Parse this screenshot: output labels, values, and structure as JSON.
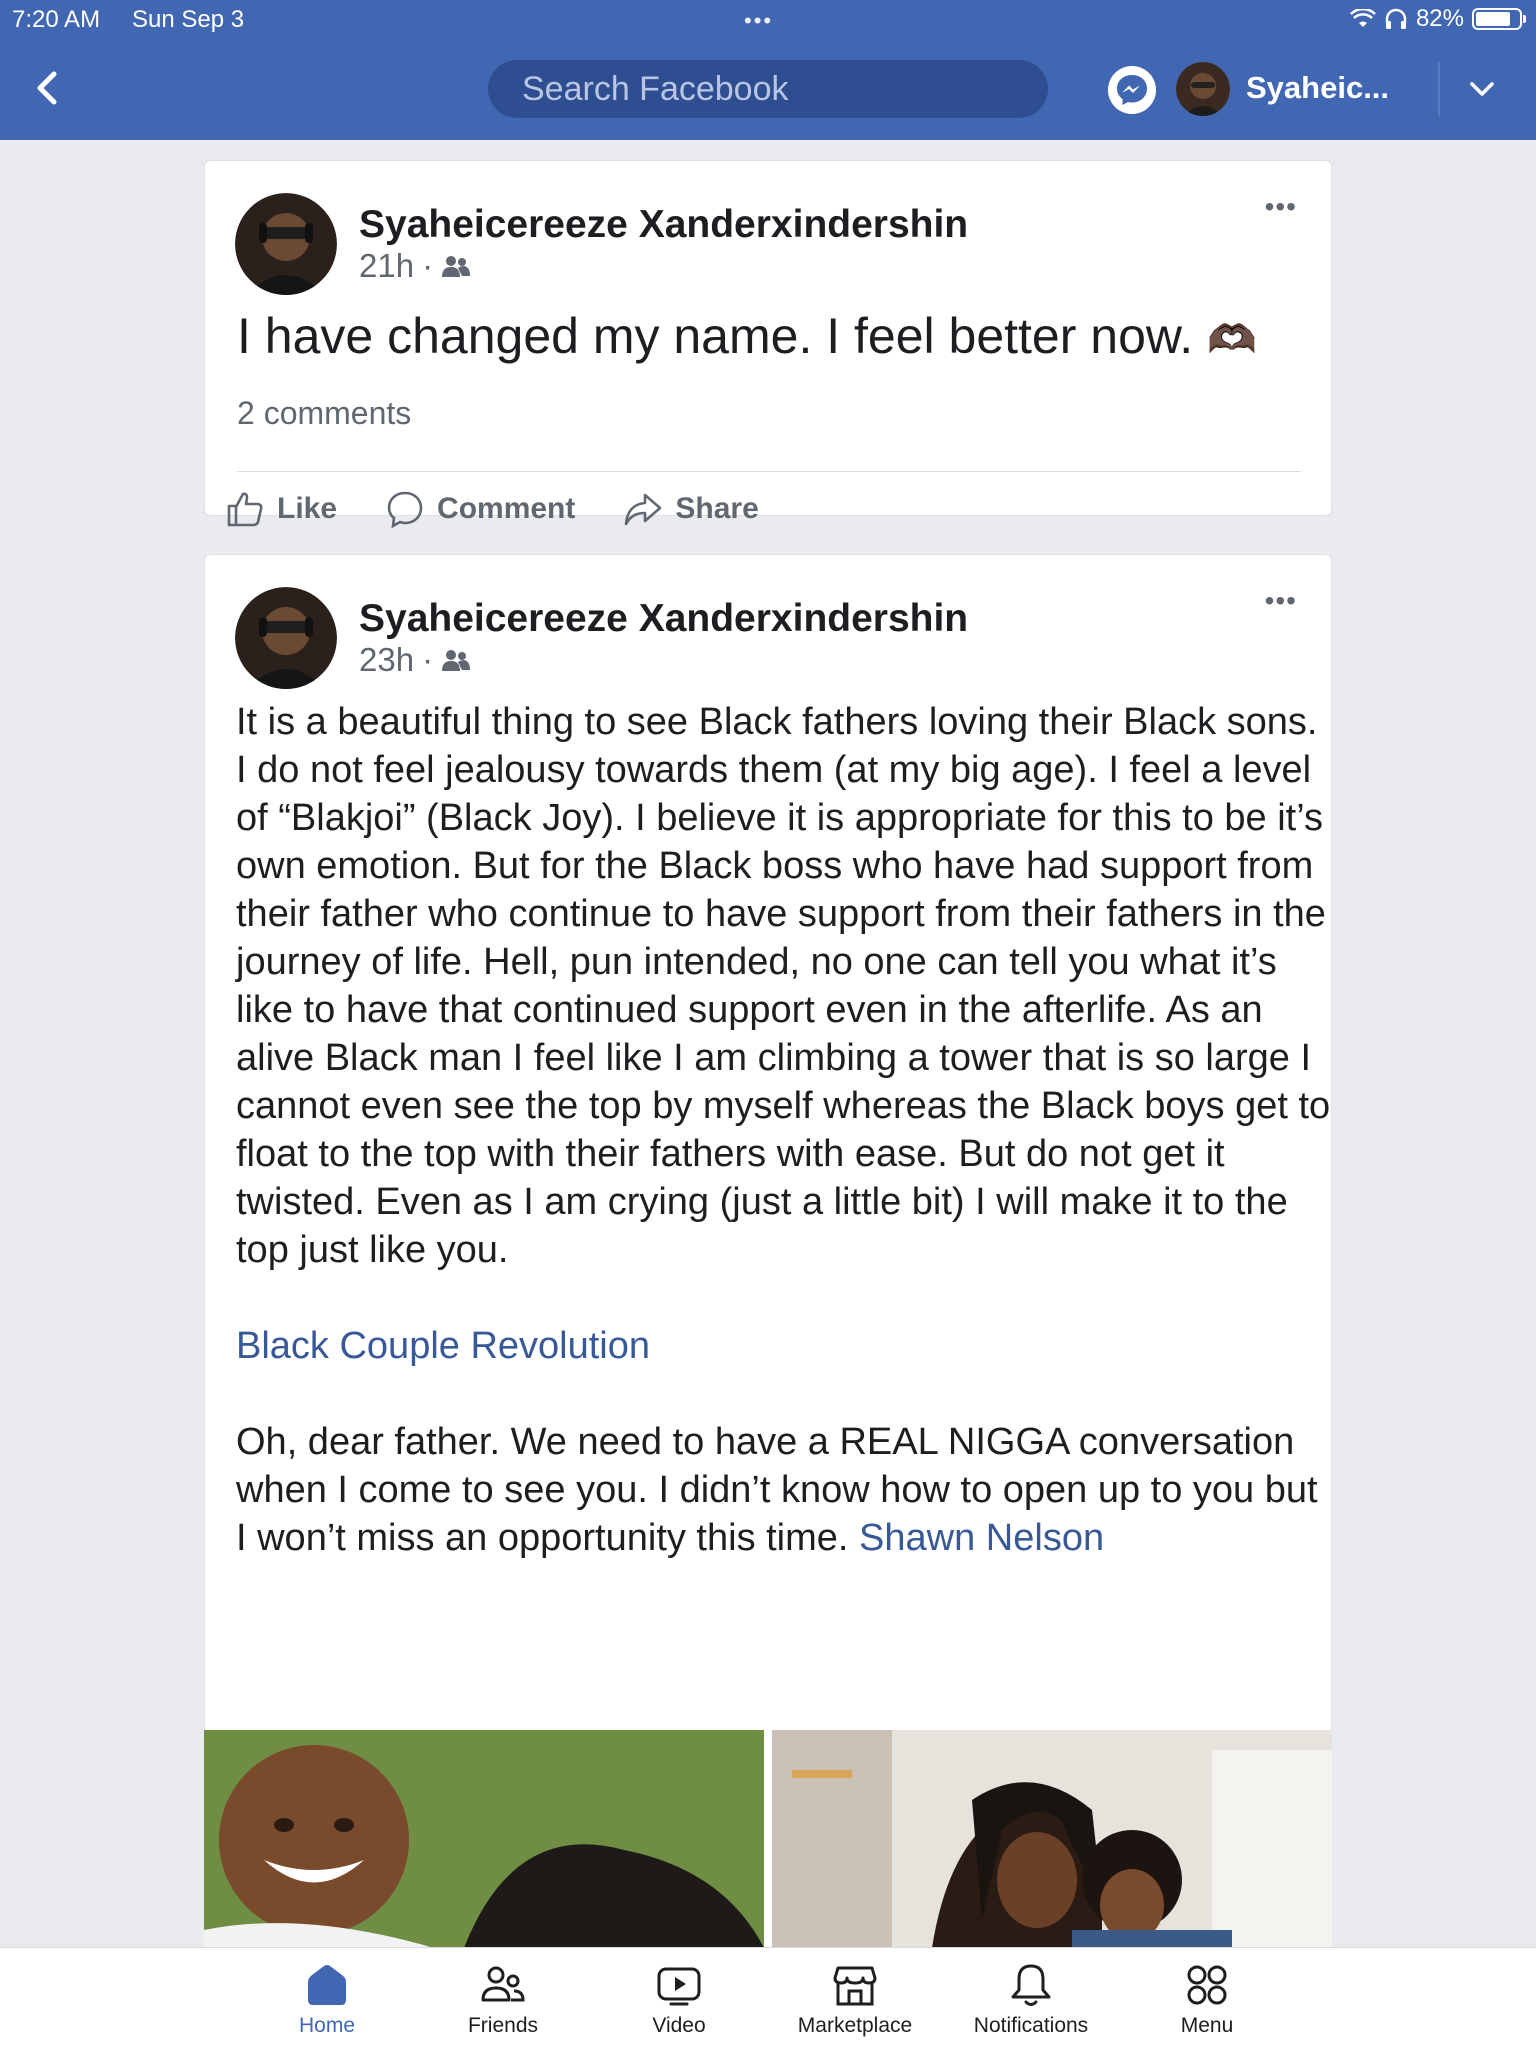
{
  "status_bar": {
    "time": "7:20 AM",
    "date": "Sun Sep 3",
    "dots": "•••",
    "battery": "82%",
    "battery_level": 0.82
  },
  "header": {
    "search_placeholder": "Search Facebook",
    "username": "Syaheic..."
  },
  "posts": [
    {
      "author": "Syaheicereeze Xanderxindershin",
      "time": "21h",
      "dot": "·",
      "text": "I have changed my name. I feel better now.",
      "emoji": "🫶🏿",
      "comments": "2 comments",
      "more": "•••",
      "actions": {
        "like": "Like",
        "comment": "Comment",
        "share": "Share"
      }
    },
    {
      "author": "Syaheicereeze Xanderxindershin",
      "time": "23h",
      "dot": "·",
      "more": "•••",
      "paragraph1": "It is a beautiful thing to see Black fathers loving their Black sons. I do not feel jealousy towards them (at my big age). I feel a level of “Blakjoi” (Black Joy). I believe it is appropriate for this to be it’s own emotion. But for the Black boss who have had support from their father who continue to have support from their fathers in the journey of life. Hell, pun intended, no one can tell you what it’s like to have that continued support even in the afterlife. As an alive Black man I feel like I am climbing a tower that is so large I cannot even see the top by myself whereas the Black boys get to float to the top with their fathers with ease. But do not get it twisted. Even as I am crying (just a little bit) I will make it to the top just like you.",
      "page_link": "Black Couple Revolution",
      "paragraph2": "Oh, dear father. We need to have a REAL NIGGA conversation when I come to see you. I didn’t know how to open up to you but I won’t miss an opportunity this time.",
      "mention": "Shawn Nelson"
    }
  ],
  "tabs": [
    {
      "label": "Home",
      "icon": "home-icon",
      "active": true
    },
    {
      "label": "Friends",
      "icon": "friends-icon"
    },
    {
      "label": "Video",
      "icon": "video-icon"
    },
    {
      "label": "Marketplace",
      "icon": "marketplace-icon"
    },
    {
      "label": "Notifications",
      "icon": "bell-icon"
    },
    {
      "label": "Menu",
      "icon": "menu-grid-icon"
    }
  ],
  "colors": {
    "brand_blue": "#4267b2",
    "link_blue": "#385898",
    "background": "#e9ebee"
  }
}
